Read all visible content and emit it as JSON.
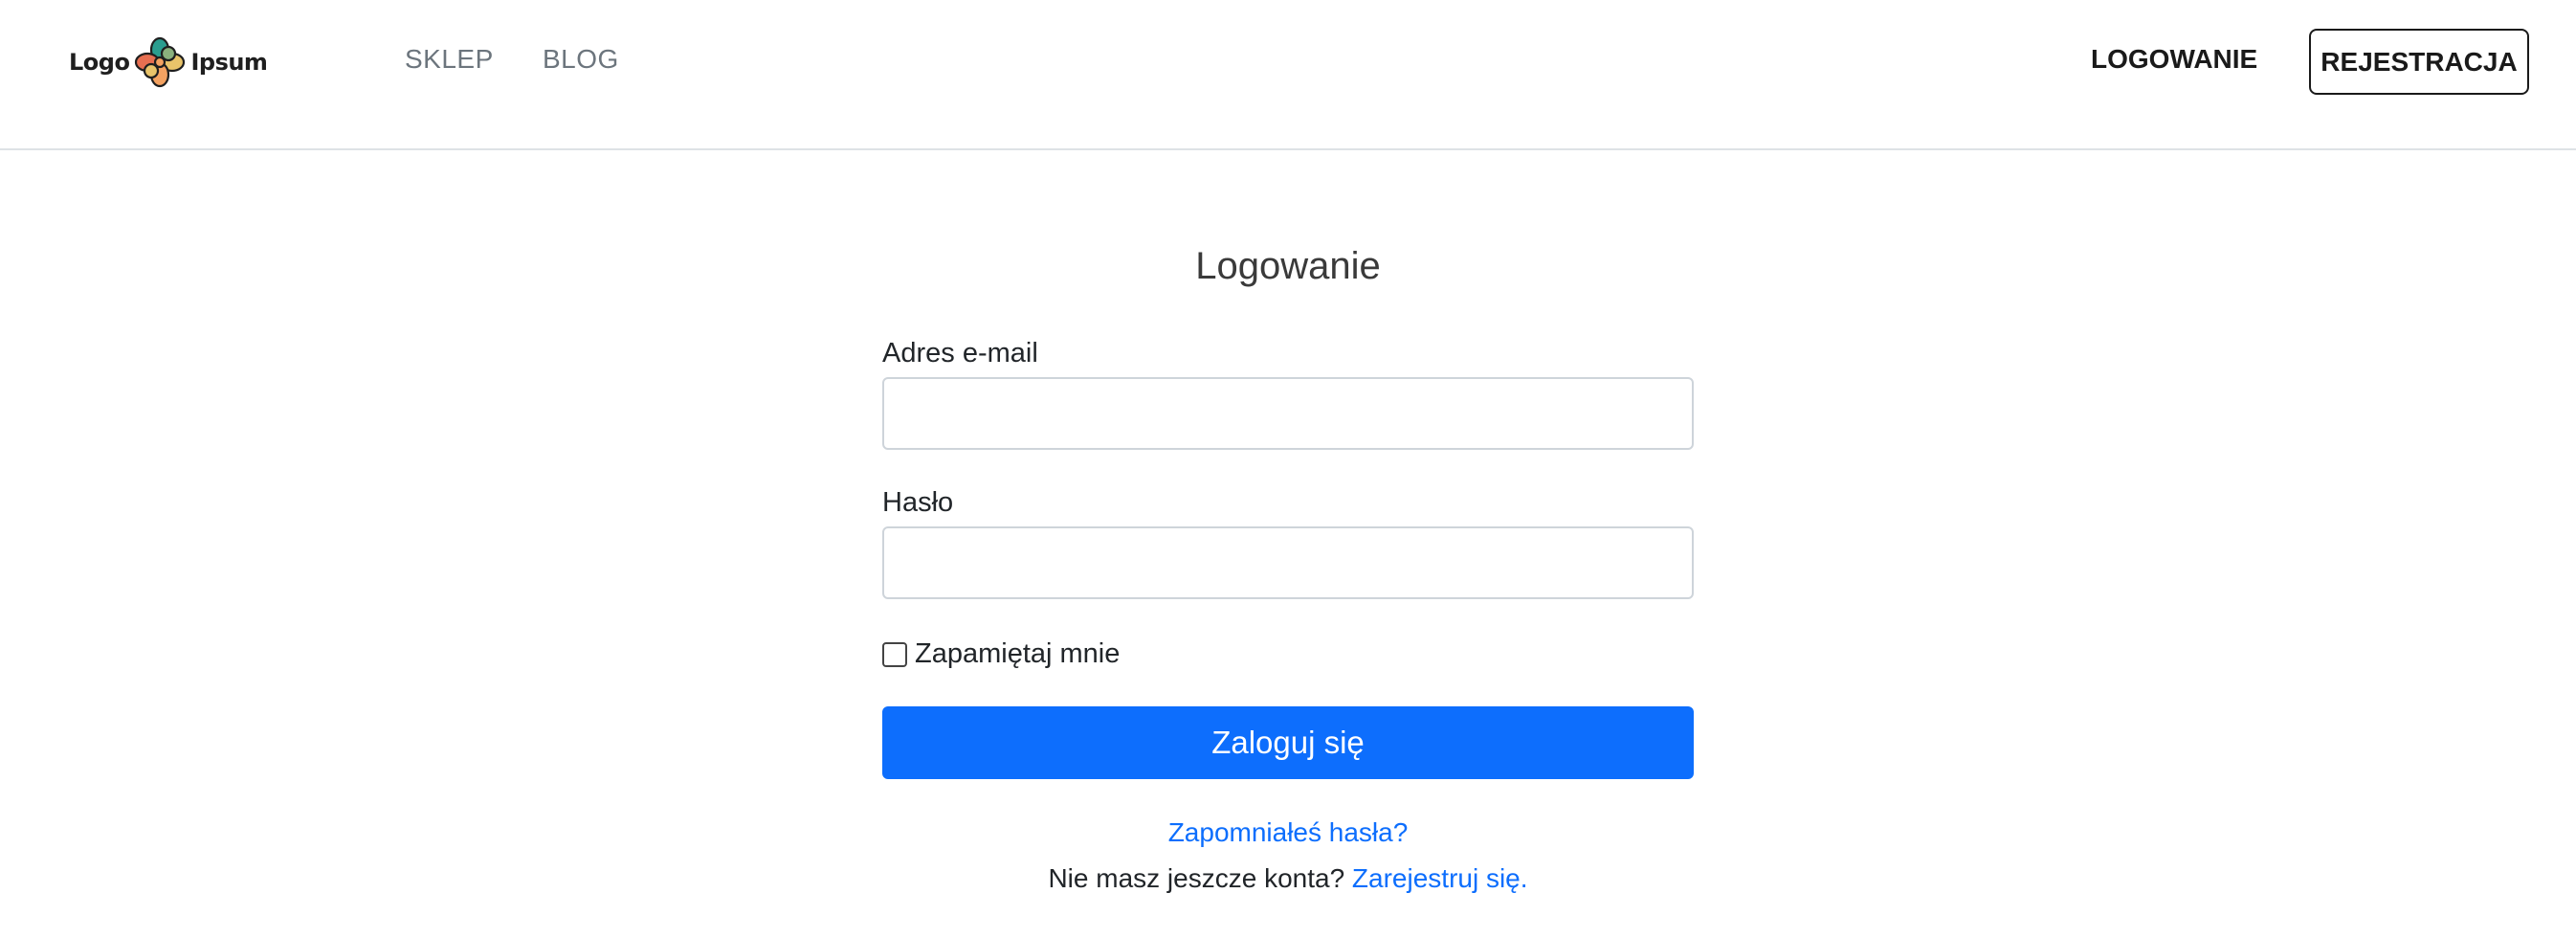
{
  "header": {
    "logo": {
      "word_left": "Logo",
      "word_right": "Ipsum",
      "icon": "flower-logo-icon",
      "petal_colors": [
        "#2a9d8f",
        "#e9c46a",
        "#f4a261",
        "#e76f51",
        "#8ab17d"
      ]
    },
    "nav": [
      {
        "label": "SKLEP"
      },
      {
        "label": "BLOG"
      }
    ],
    "login_label": "LOGOWANIE",
    "register_label": "REJESTRACJA"
  },
  "login_form": {
    "title": "Logowanie",
    "email_label": "Adres e-mail",
    "email_value": "",
    "email_placeholder": "",
    "password_label": "Hasło",
    "password_value": "",
    "password_placeholder": "",
    "remember_label": "Zapamiętaj mnie",
    "remember_checked": false,
    "submit_label": "Zaloguj się",
    "forgot_label": "Zapomniałeś hasła?",
    "no_account_text": "Nie masz jeszcze konta?",
    "signup_link_label": "Zarejestruj się."
  },
  "colors": {
    "primary": "#0d6efd",
    "text": "#212529",
    "muted_nav": "#6c757d",
    "border": "#ced4da"
  }
}
